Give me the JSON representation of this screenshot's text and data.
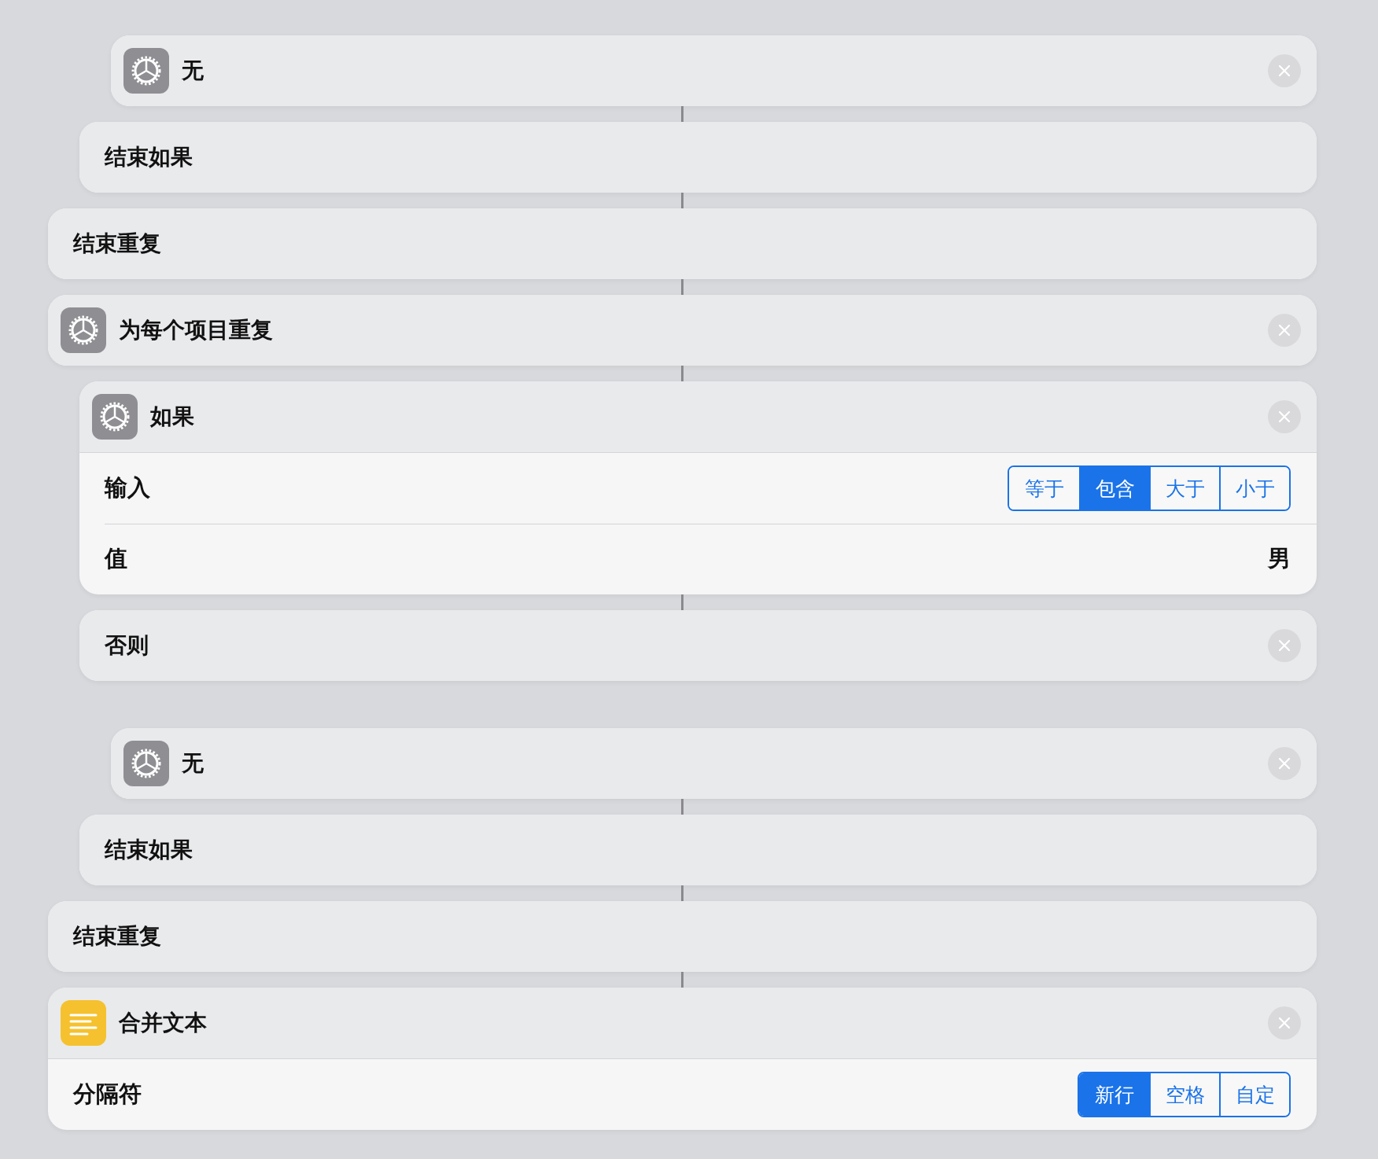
{
  "actions": [
    {
      "children": [
        {
          "children": [
            {
              "title": "无",
              "kind": "scripting",
              "removable": true
            }
          ]
        },
        {
          "title": "结束如果",
          "removable": false,
          "connector_above": true
        }
      ]
    },
    {
      "title": "结束重复",
      "removable": false,
      "connector_above": true
    },
    {
      "title": "为每个项目重复",
      "kind": "scripting",
      "removable": true,
      "connector_above": true,
      "children": [
        {
          "title": "如果",
          "kind": "scripting",
          "removable": true,
          "connector_above": true,
          "rows": [
            {
              "kind": "segmented",
              "label": "输入",
              "options": [
                {
                  "label": "等于",
                  "selected": false
                },
                {
                  "label": "包含",
                  "selected": true
                },
                {
                  "label": "大于",
                  "selected": false
                },
                {
                  "label": "小于",
                  "selected": false
                }
              ]
            },
            {
              "kind": "value",
              "label": "值",
              "value": "男"
            }
          ]
        },
        {
          "title": "否则",
          "removable": true,
          "connector_above": true,
          "children": [
            {
              "title": "无",
              "kind": "scripting",
              "removable": true,
              "connector_above": false
            }
          ]
        },
        {
          "title": "结束如果",
          "removable": false,
          "connector_above": true
        }
      ]
    },
    {
      "title": "结束重复",
      "removable": false,
      "connector_above": true
    },
    {
      "title": "合并文本",
      "kind": "text-tool",
      "removable": true,
      "connector_above": true,
      "rows": [
        {
          "kind": "segmented",
          "label": "分隔符",
          "options": [
            {
              "label": "新行",
              "selected": true
            },
            {
              "label": "空格",
              "selected": false
            },
            {
              "label": "自定",
              "selected": false
            }
          ]
        }
      ]
    }
  ]
}
